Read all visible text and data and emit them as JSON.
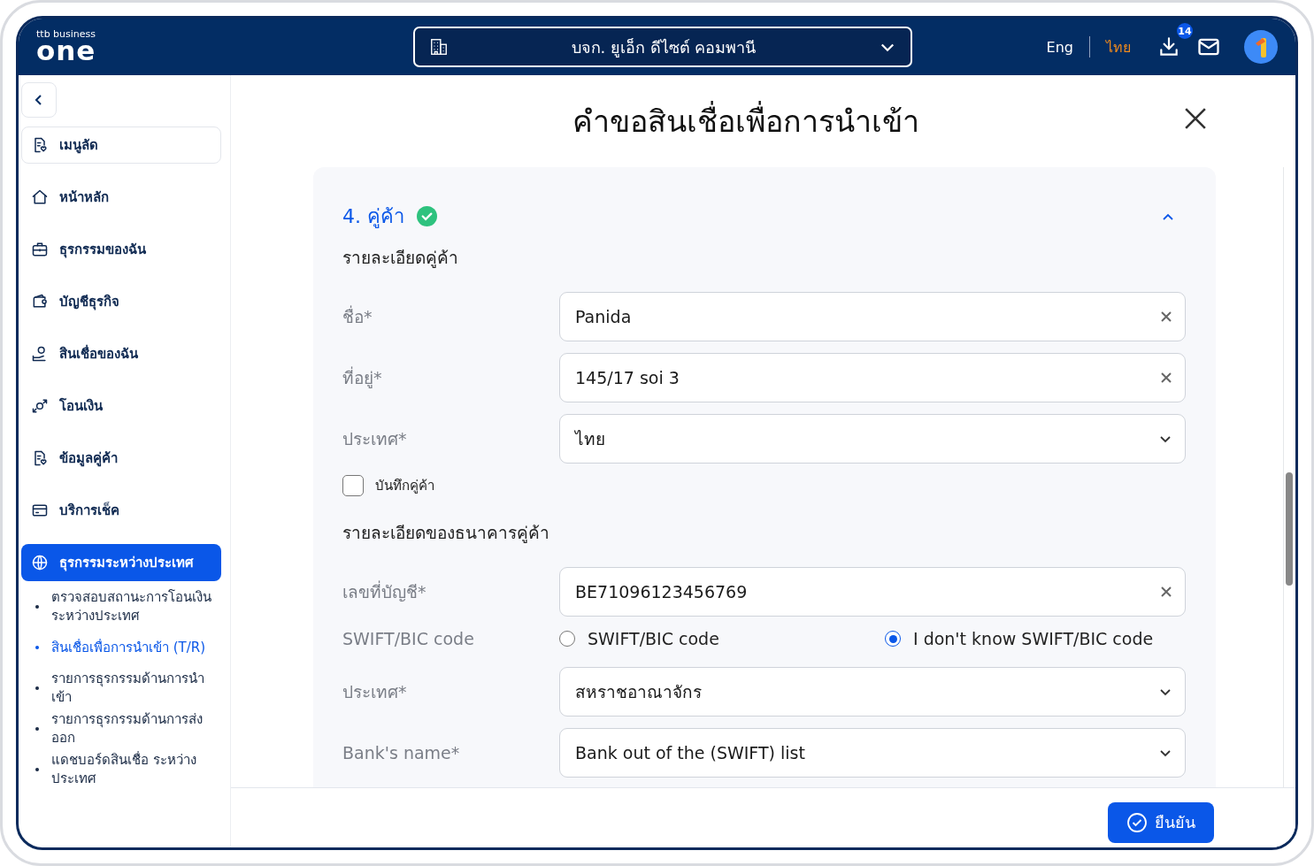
{
  "header": {
    "logo_top": "ttb business",
    "logo_main": "one",
    "company": "บจก. ยูเอ็ก ดีไซต์ คอมพานี",
    "languages": [
      {
        "label": "Eng",
        "selected": false
      },
      {
        "label": "ไทย",
        "selected": true
      }
    ],
    "download_badge": "14"
  },
  "sidebar": {
    "items": [
      {
        "kind": "shortcut",
        "label": "เมนูลัด",
        "selected": false
      },
      {
        "kind": "home",
        "label": "หน้าหลัก",
        "selected": false
      },
      {
        "kind": "briefcase",
        "label": "ธุรกรรมของฉัน",
        "selected": false
      },
      {
        "kind": "wallet",
        "label": "บัญชีธุรกิจ",
        "selected": false
      },
      {
        "kind": "loan",
        "label": "สินเชื่อของฉัน",
        "selected": false
      },
      {
        "kind": "transfer",
        "label": "โอนเงิน",
        "selected": false
      },
      {
        "kind": "partner",
        "label": "ข้อมูลคู่ค้า",
        "selected": false
      },
      {
        "kind": "cheque",
        "label": "บริการเช็ค",
        "selected": false
      },
      {
        "kind": "globe",
        "label": "ธุรกรรมระหว่างประเทศ",
        "selected": true,
        "children": [
          {
            "label": "ตรวจสอบสถานะการโอนเงินระหว่างประเทศ",
            "selected": false
          },
          {
            "label": "สินเชื่อเพื่อการนำเข้า (T/R)",
            "selected": true
          },
          {
            "label": "รายการธุรกรรมด้านการนำเข้า",
            "selected": false
          },
          {
            "label": "รายการธุรกรรมด้านการส่งออก",
            "selected": false
          },
          {
            "label": "แดชบอร์ดสินเชื่อ ระหว่างประเทศ",
            "selected": false
          }
        ]
      }
    ]
  },
  "page": {
    "title": "คำขอสินเชื่อเพื่อการนำเข้า"
  },
  "section": {
    "title": "4. คู่ค้า",
    "completed": true,
    "expanded": true,
    "groups": [
      {
        "heading": "รายละเอียดคู่ค้า",
        "fields": [
          {
            "kind": "text",
            "label": "ชื่อ*",
            "value": "Panida"
          },
          {
            "kind": "text",
            "label": "ที่อยู่*",
            "value": "145/17 soi 3"
          },
          {
            "kind": "select",
            "label": "ประเทศ*",
            "value": "ไทย"
          }
        ],
        "checkbox": {
          "label": "บันทึกคู่ค้า",
          "checked": false
        }
      },
      {
        "heading": "รายละเอียดของธนาคารคู่ค้า",
        "fields": [
          {
            "kind": "text",
            "label": "เลขที่บัญชี*",
            "value": "BE71096123456769"
          },
          {
            "kind": "radio",
            "label": "SWIFT/BIC code",
            "options": [
              {
                "label": "SWIFT/BIC code",
                "selected": false
              },
              {
                "label": "I don't know SWIFT/BIC code",
                "selected": true
              }
            ]
          },
          {
            "kind": "select",
            "label": "ประเทศ*",
            "value": "สหราชอาณาจักร"
          },
          {
            "kind": "select",
            "label": "Bank's name*",
            "value": "Bank out of the (SWIFT) list"
          }
        ]
      }
    ]
  },
  "footer": {
    "confirm": "ยืนยัน"
  }
}
